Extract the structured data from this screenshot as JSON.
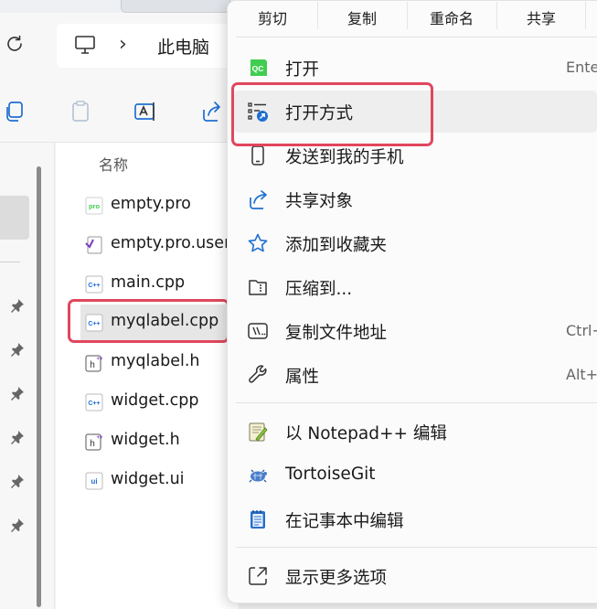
{
  "address": {
    "location": "此电脑"
  },
  "file_list": {
    "column_header": "名称",
    "files": [
      {
        "name": "empty.pro",
        "icon": "qt-pro-file-icon"
      },
      {
        "name": "empty.pro.user",
        "icon": "qt-user-file-icon"
      },
      {
        "name": "main.cpp",
        "icon": "cpp-file-icon"
      },
      {
        "name": "myqlabel.cpp",
        "icon": "cpp-file-icon",
        "selected": true
      },
      {
        "name": "myqlabel.h",
        "icon": "header-file-icon"
      },
      {
        "name": "widget.cpp",
        "icon": "cpp-file-icon"
      },
      {
        "name": "widget.h",
        "icon": "header-file-icon"
      },
      {
        "name": "widget.ui",
        "icon": "ui-file-icon"
      }
    ]
  },
  "context_menu": {
    "quick_actions": [
      "剪切",
      "复制",
      "重命名",
      "共享"
    ],
    "items": [
      {
        "label": "打开",
        "shortcut": "Ente",
        "icon": "qt-open-icon"
      },
      {
        "label": "打开方式",
        "shortcut": "",
        "icon": "open-with-icon",
        "hovered": true
      },
      {
        "label": "发送到我的手机",
        "shortcut": "",
        "icon": "phone-icon"
      },
      {
        "label": "共享对象",
        "shortcut": "",
        "icon": "share-icon"
      },
      {
        "label": "添加到收藏夹",
        "shortcut": "",
        "icon": "star-icon"
      },
      {
        "label": "压缩到...",
        "shortcut": "",
        "icon": "zip-folder-icon"
      },
      {
        "label": "复制文件地址",
        "shortcut": "Ctrl+",
        "icon": "copy-path-icon"
      },
      {
        "label": "属性",
        "shortcut": "Alt+",
        "icon": "wrench-icon"
      },
      {
        "label": "以 Notepad++ 编辑",
        "shortcut": "",
        "icon": "notepad-plus-plus-icon"
      },
      {
        "label": "TortoiseGit",
        "shortcut": "",
        "icon": "tortoisegit-icon"
      },
      {
        "label": "在记事本中编辑",
        "shortcut": "",
        "icon": "notepad-icon"
      },
      {
        "label": "显示更多选项",
        "shortcut": "",
        "icon": "show-more-icon"
      }
    ]
  },
  "colors": {
    "highlight": "#e0475d",
    "accent": "#1f6fd1",
    "qt_green": "#41cd52"
  }
}
